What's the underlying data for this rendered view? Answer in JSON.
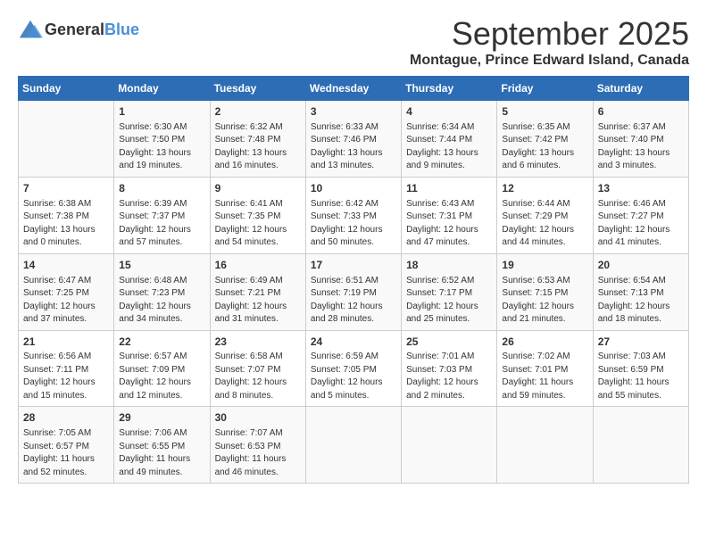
{
  "logo": {
    "text_general": "General",
    "text_blue": "Blue"
  },
  "header": {
    "month_year": "September 2025",
    "location": "Montague, Prince Edward Island, Canada"
  },
  "columns": [
    "Sunday",
    "Monday",
    "Tuesday",
    "Wednesday",
    "Thursday",
    "Friday",
    "Saturday"
  ],
  "weeks": [
    [
      {
        "day": "",
        "sunrise": "",
        "sunset": "",
        "daylight": ""
      },
      {
        "day": "1",
        "sunrise": "Sunrise: 6:30 AM",
        "sunset": "Sunset: 7:50 PM",
        "daylight": "Daylight: 13 hours and 19 minutes."
      },
      {
        "day": "2",
        "sunrise": "Sunrise: 6:32 AM",
        "sunset": "Sunset: 7:48 PM",
        "daylight": "Daylight: 13 hours and 16 minutes."
      },
      {
        "day": "3",
        "sunrise": "Sunrise: 6:33 AM",
        "sunset": "Sunset: 7:46 PM",
        "daylight": "Daylight: 13 hours and 13 minutes."
      },
      {
        "day": "4",
        "sunrise": "Sunrise: 6:34 AM",
        "sunset": "Sunset: 7:44 PM",
        "daylight": "Daylight: 13 hours and 9 minutes."
      },
      {
        "day": "5",
        "sunrise": "Sunrise: 6:35 AM",
        "sunset": "Sunset: 7:42 PM",
        "daylight": "Daylight: 13 hours and 6 minutes."
      },
      {
        "day": "6",
        "sunrise": "Sunrise: 6:37 AM",
        "sunset": "Sunset: 7:40 PM",
        "daylight": "Daylight: 13 hours and 3 minutes."
      }
    ],
    [
      {
        "day": "7",
        "sunrise": "Sunrise: 6:38 AM",
        "sunset": "Sunset: 7:38 PM",
        "daylight": "Daylight: 13 hours and 0 minutes."
      },
      {
        "day": "8",
        "sunrise": "Sunrise: 6:39 AM",
        "sunset": "Sunset: 7:37 PM",
        "daylight": "Daylight: 12 hours and 57 minutes."
      },
      {
        "day": "9",
        "sunrise": "Sunrise: 6:41 AM",
        "sunset": "Sunset: 7:35 PM",
        "daylight": "Daylight: 12 hours and 54 minutes."
      },
      {
        "day": "10",
        "sunrise": "Sunrise: 6:42 AM",
        "sunset": "Sunset: 7:33 PM",
        "daylight": "Daylight: 12 hours and 50 minutes."
      },
      {
        "day": "11",
        "sunrise": "Sunrise: 6:43 AM",
        "sunset": "Sunset: 7:31 PM",
        "daylight": "Daylight: 12 hours and 47 minutes."
      },
      {
        "day": "12",
        "sunrise": "Sunrise: 6:44 AM",
        "sunset": "Sunset: 7:29 PM",
        "daylight": "Daylight: 12 hours and 44 minutes."
      },
      {
        "day": "13",
        "sunrise": "Sunrise: 6:46 AM",
        "sunset": "Sunset: 7:27 PM",
        "daylight": "Daylight: 12 hours and 41 minutes."
      }
    ],
    [
      {
        "day": "14",
        "sunrise": "Sunrise: 6:47 AM",
        "sunset": "Sunset: 7:25 PM",
        "daylight": "Daylight: 12 hours and 37 minutes."
      },
      {
        "day": "15",
        "sunrise": "Sunrise: 6:48 AM",
        "sunset": "Sunset: 7:23 PM",
        "daylight": "Daylight: 12 hours and 34 minutes."
      },
      {
        "day": "16",
        "sunrise": "Sunrise: 6:49 AM",
        "sunset": "Sunset: 7:21 PM",
        "daylight": "Daylight: 12 hours and 31 minutes."
      },
      {
        "day": "17",
        "sunrise": "Sunrise: 6:51 AM",
        "sunset": "Sunset: 7:19 PM",
        "daylight": "Daylight: 12 hours and 28 minutes."
      },
      {
        "day": "18",
        "sunrise": "Sunrise: 6:52 AM",
        "sunset": "Sunset: 7:17 PM",
        "daylight": "Daylight: 12 hours and 25 minutes."
      },
      {
        "day": "19",
        "sunrise": "Sunrise: 6:53 AM",
        "sunset": "Sunset: 7:15 PM",
        "daylight": "Daylight: 12 hours and 21 minutes."
      },
      {
        "day": "20",
        "sunrise": "Sunrise: 6:54 AM",
        "sunset": "Sunset: 7:13 PM",
        "daylight": "Daylight: 12 hours and 18 minutes."
      }
    ],
    [
      {
        "day": "21",
        "sunrise": "Sunrise: 6:56 AM",
        "sunset": "Sunset: 7:11 PM",
        "daylight": "Daylight: 12 hours and 15 minutes."
      },
      {
        "day": "22",
        "sunrise": "Sunrise: 6:57 AM",
        "sunset": "Sunset: 7:09 PM",
        "daylight": "Daylight: 12 hours and 12 minutes."
      },
      {
        "day": "23",
        "sunrise": "Sunrise: 6:58 AM",
        "sunset": "Sunset: 7:07 PM",
        "daylight": "Daylight: 12 hours and 8 minutes."
      },
      {
        "day": "24",
        "sunrise": "Sunrise: 6:59 AM",
        "sunset": "Sunset: 7:05 PM",
        "daylight": "Daylight: 12 hours and 5 minutes."
      },
      {
        "day": "25",
        "sunrise": "Sunrise: 7:01 AM",
        "sunset": "Sunset: 7:03 PM",
        "daylight": "Daylight: 12 hours and 2 minutes."
      },
      {
        "day": "26",
        "sunrise": "Sunrise: 7:02 AM",
        "sunset": "Sunset: 7:01 PM",
        "daylight": "Daylight: 11 hours and 59 minutes."
      },
      {
        "day": "27",
        "sunrise": "Sunrise: 7:03 AM",
        "sunset": "Sunset: 6:59 PM",
        "daylight": "Daylight: 11 hours and 55 minutes."
      }
    ],
    [
      {
        "day": "28",
        "sunrise": "Sunrise: 7:05 AM",
        "sunset": "Sunset: 6:57 PM",
        "daylight": "Daylight: 11 hours and 52 minutes."
      },
      {
        "day": "29",
        "sunrise": "Sunrise: 7:06 AM",
        "sunset": "Sunset: 6:55 PM",
        "daylight": "Daylight: 11 hours and 49 minutes."
      },
      {
        "day": "30",
        "sunrise": "Sunrise: 7:07 AM",
        "sunset": "Sunset: 6:53 PM",
        "daylight": "Daylight: 11 hours and 46 minutes."
      },
      {
        "day": "",
        "sunrise": "",
        "sunset": "",
        "daylight": ""
      },
      {
        "day": "",
        "sunrise": "",
        "sunset": "",
        "daylight": ""
      },
      {
        "day": "",
        "sunrise": "",
        "sunset": "",
        "daylight": ""
      },
      {
        "day": "",
        "sunrise": "",
        "sunset": "",
        "daylight": ""
      }
    ]
  ]
}
